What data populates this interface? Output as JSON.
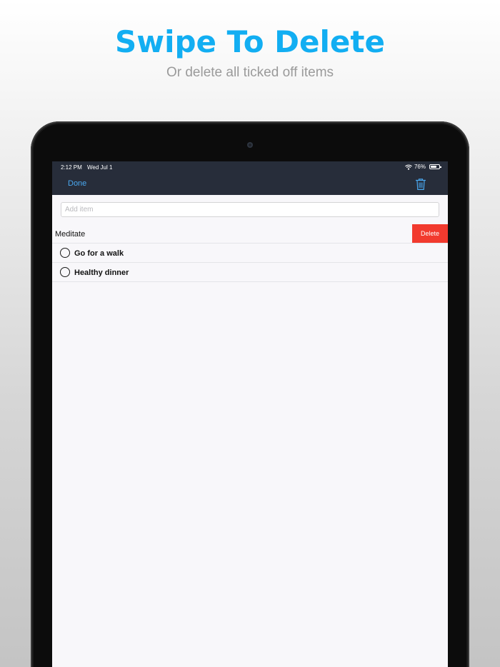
{
  "headline": "Swipe To Delete",
  "subheadline": "Or delete all ticked off items",
  "status_bar": {
    "time": "2:12 PM",
    "date": "Wed Jul 1",
    "battery_text": "76%",
    "battery_level": 0.76,
    "wifi_icon": "wifi-icon",
    "battery_icon": "battery-icon"
  },
  "nav": {
    "done_label": "Done",
    "trash_icon": "trash-icon"
  },
  "add_item": {
    "placeholder": "Add item",
    "value": ""
  },
  "items": [
    {
      "label": "Meditate",
      "swiped": true,
      "action_label": "Delete"
    },
    {
      "label": "Go for a walk",
      "checked": false
    },
    {
      "label": "Healthy dinner",
      "checked": false
    }
  ],
  "colors": {
    "headline": "#12aef2",
    "subheadline": "#9a9a9a",
    "navbar": "#272d3a",
    "accent": "#4aa8f0",
    "delete": "#f23a2e",
    "list_background": "#f8f7fa"
  }
}
